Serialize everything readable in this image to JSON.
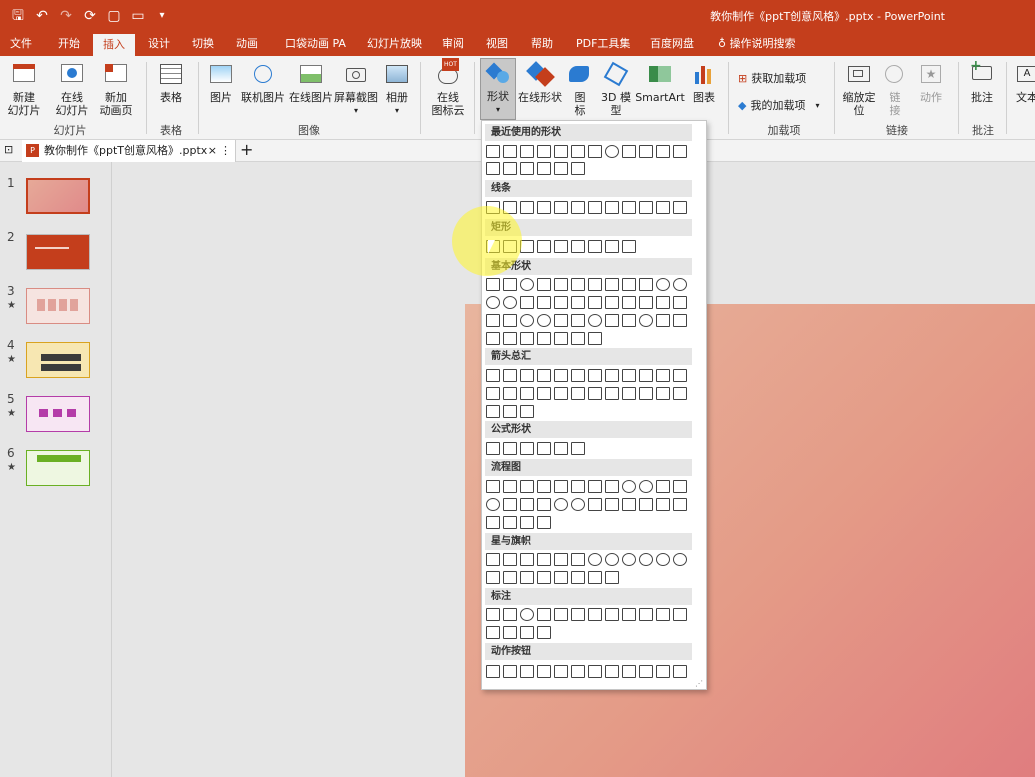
{
  "titlebar": {
    "doc_title": "教你制作《pptT创意风格》.pptx - PowerPoint",
    "qat": [
      "save-icon",
      "undo-icon",
      "redo-icon",
      "presenter-icon",
      "new-icon",
      "open-icon",
      "customize-icon"
    ]
  },
  "tabs": [
    "文件",
    "开始",
    "插入",
    "设计",
    "切换",
    "动画",
    "口袋动画 PA",
    "幻灯片放映",
    "审阅",
    "视图",
    "帮助",
    "PDF工具集",
    "百度网盘",
    "操作说明搜索"
  ],
  "ribbon": {
    "buttons": {
      "new_slide": "新建\n幻灯片",
      "online_slide": "在线\n幻灯片",
      "new_anim_page": "新加\n动画页",
      "table": "表格",
      "picture": "图片",
      "online_pic": "联机图片",
      "online_pic2": "在线图片",
      "screenshot": "屏幕截图",
      "album": "相册",
      "online_icons": "在线\n图标云",
      "shapes": "形状",
      "online_shapes": "在线形状",
      "icons": "图\n标",
      "model3d": "3D 模\n型",
      "smartart": "SmartArt",
      "chart": "图表",
      "get_addins": "获取加载项",
      "my_addins": "我的加载项",
      "zoom": "缩放定\n位",
      "link": "链\n接",
      "action": "动作",
      "comment": "批注",
      "textbox": "文本"
    },
    "groups": {
      "slides": "幻灯片",
      "tables": "表格",
      "images": "图像",
      "addins": "加载项",
      "links": "链接",
      "comments": "批注"
    },
    "hot_badge": "HOT"
  },
  "doc_tab": {
    "label": "教你制作《pptT创意风格》.pptx",
    "close": "×",
    "menu": "⋮",
    "add": "+"
  },
  "slides": [
    {
      "num": "1",
      "star": ""
    },
    {
      "num": "2",
      "star": ""
    },
    {
      "num": "3",
      "star": "★"
    },
    {
      "num": "4",
      "star": "★"
    },
    {
      "num": "5",
      "star": "★"
    },
    {
      "num": "6",
      "star": "★"
    }
  ],
  "colors": {
    "accent": "#c43e1c",
    "slide_bg": "#e49b87"
  },
  "gallery": {
    "sections": [
      "最近使用的形状",
      "线条",
      "矩形",
      "基本形状",
      "箭头总汇",
      "公式形状",
      "流程图",
      "星与旗帜",
      "标注",
      "动作按钮"
    ]
  }
}
